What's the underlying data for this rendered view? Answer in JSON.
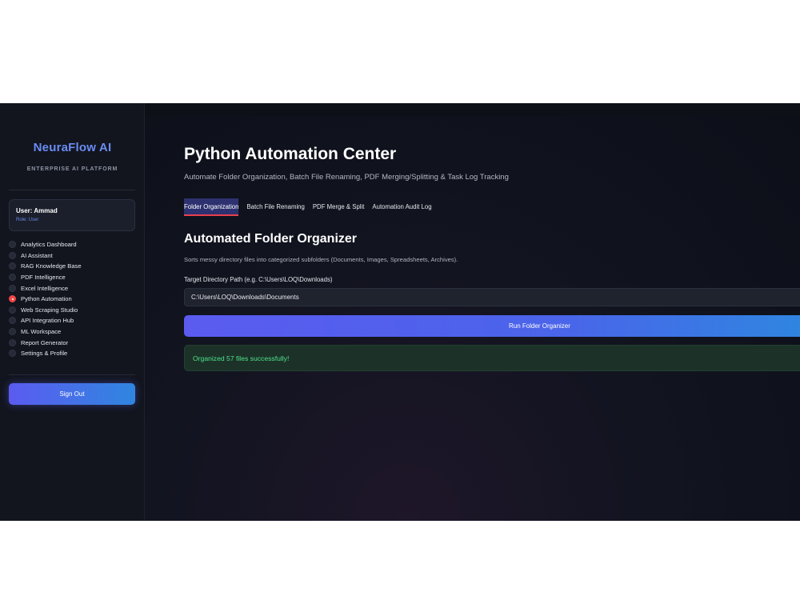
{
  "sidebar": {
    "brand": "NeuraFlow AI",
    "brand_subtitle": "ENTERPRISE AI PLATFORM",
    "user": {
      "name": "User: Ammad",
      "role": "Role: User"
    },
    "nav_items": [
      {
        "label": "Analytics Dashboard",
        "active": false
      },
      {
        "label": "AI Assistant",
        "active": false
      },
      {
        "label": "RAG Knowledge Base",
        "active": false
      },
      {
        "label": "PDF Intelligence",
        "active": false
      },
      {
        "label": "Excel Intelligence",
        "active": false
      },
      {
        "label": "Python Automation",
        "active": true
      },
      {
        "label": "Web Scraping Studio",
        "active": false
      },
      {
        "label": "API Integration Hub",
        "active": false
      },
      {
        "label": "ML Workspace",
        "active": false
      },
      {
        "label": "Report Generator",
        "active": false
      },
      {
        "label": "Settings & Profile",
        "active": false
      }
    ],
    "sign_out_label": "Sign Out"
  },
  "main": {
    "title": "Python Automation Center",
    "subtitle": "Automate Folder Organization, Batch File Renaming, PDF Merging/Splitting & Task Log Tracking",
    "tabs": [
      {
        "label": "Folder Organization",
        "active": true
      },
      {
        "label": "Batch File Renaming",
        "active": false
      },
      {
        "label": "PDF Merge & Split",
        "active": false
      },
      {
        "label": "Automation Audit Log",
        "active": false
      }
    ],
    "section_title": "Automated Folder Organizer",
    "section_description": "Sorts messy directory files into categorized subfolders (Documents, Images, Spreadsheets, Archives).",
    "path_label": "Target Directory Path (e.g. C:\\Users\\LOQ\\Downloads)",
    "path_value": "C:\\Users\\LOQ\\Downloads\\Documents",
    "run_button_label": "Run Folder Organizer",
    "success_message": "Organized 57 files successfully!"
  },
  "colors": {
    "accent_gradient_start": "#5b5bf0",
    "accent_gradient_end": "#2f86e0",
    "active_radio": "#f04848",
    "success_text": "#4fe08a",
    "brand": "#6b8bf2"
  }
}
